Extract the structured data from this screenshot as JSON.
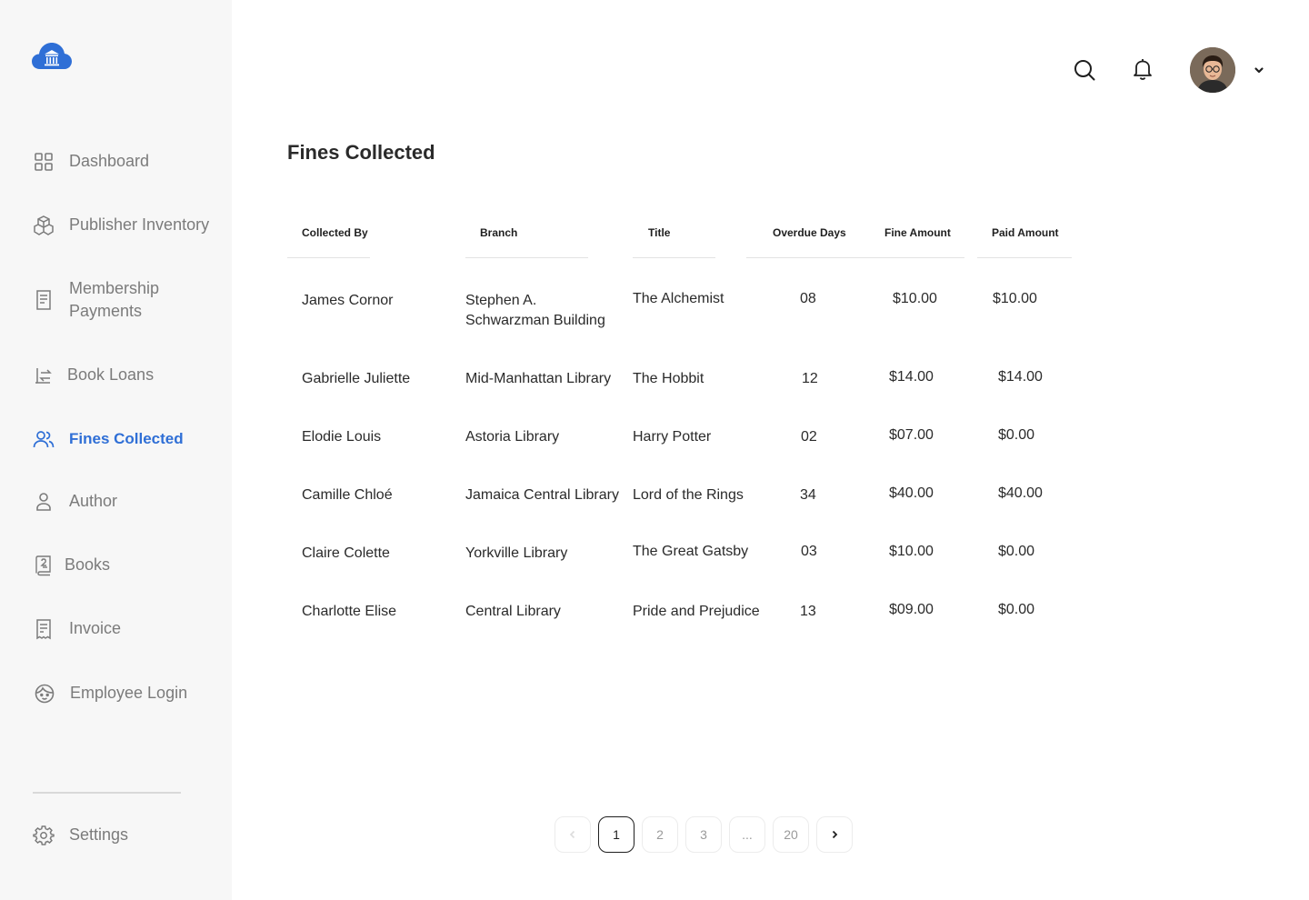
{
  "sidebar": {
    "items": [
      {
        "label": "Dashboard",
        "icon": "grid-icon"
      },
      {
        "label": "Publisher Inventory",
        "icon": "boxes-icon"
      },
      {
        "label": "Membership\nPayments",
        "icon": "receipt-icon"
      },
      {
        "label": "Book Loans",
        "icon": "exchange-icon"
      },
      {
        "label": "Fines Collected",
        "icon": "users-icon",
        "active": true
      },
      {
        "label": "Author",
        "icon": "person-icon"
      },
      {
        "label": "Books",
        "icon": "book-icon"
      },
      {
        "label": "Invoice",
        "icon": "invoice-icon"
      },
      {
        "label": "Employee Login",
        "icon": "face-icon"
      }
    ],
    "settings_label": "Settings"
  },
  "page": {
    "title": "Fines Collected"
  },
  "table": {
    "headers": [
      "Collected By",
      "Branch",
      "Title",
      "Overdue Days",
      "Fine Amount",
      "Paid Amount"
    ],
    "rows": [
      [
        "James Cornor",
        "Stephen A. Schwarzman Building",
        "The Alchemist",
        "08",
        "$10.00",
        "$10.00"
      ],
      [
        "Gabrielle Juliette",
        "Mid-Manhattan Library",
        "The Hobbit",
        "12",
        "$14.00",
        "$14.00"
      ],
      [
        "Elodie Louis",
        "Astoria Library",
        "Harry Potter",
        "02",
        "$07.00",
        "$0.00"
      ],
      [
        "Camille Chloé",
        "Jamaica Central Library",
        "Lord of the Rings",
        "34",
        "$40.00",
        "$40.00"
      ],
      [
        "Claire Colette",
        "Yorkville Library",
        "The Great Gatsby",
        "03",
        "$10.00",
        "$0.00"
      ],
      [
        "Charlotte Elise",
        "Central Library",
        "Pride and Prejudice",
        "13",
        "$09.00",
        "$0.00"
      ]
    ]
  },
  "pagination": {
    "pages": [
      "1",
      "2",
      "3",
      "...",
      "20"
    ],
    "current": "1"
  },
  "colors": {
    "accent": "#2f6fd6",
    "sidebar_bg": "#f7f7f7"
  }
}
